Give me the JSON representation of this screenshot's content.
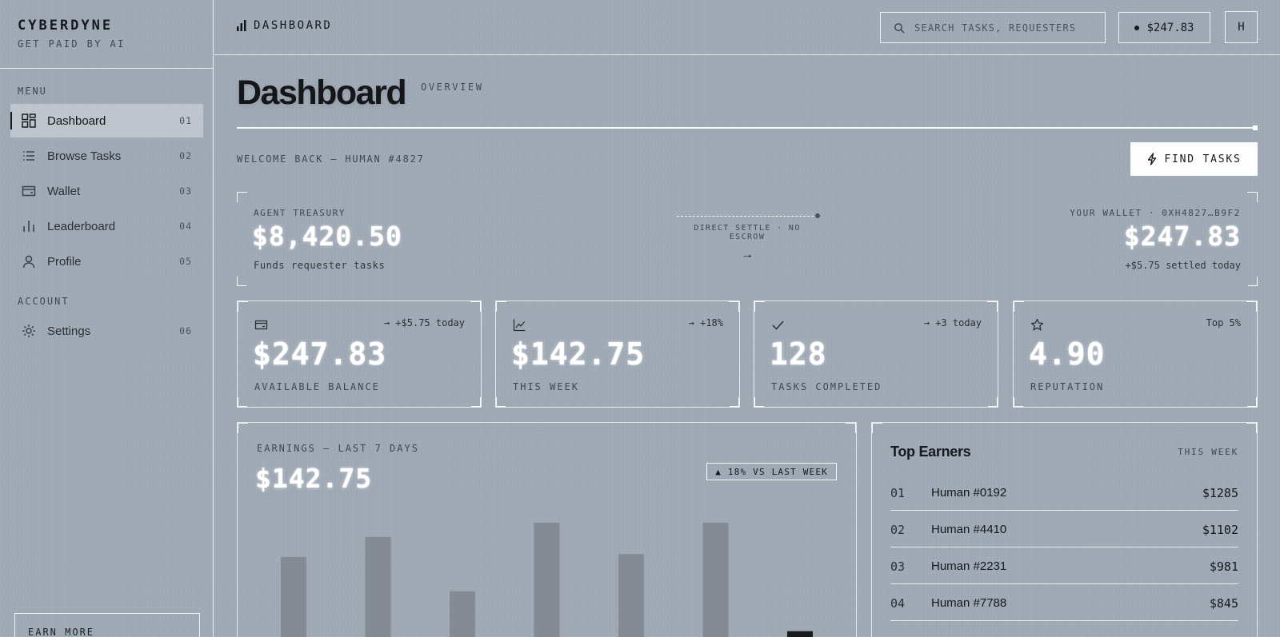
{
  "brand": {
    "name": "CYBERDYNE",
    "tagline": "GET PAID BY AI"
  },
  "sidebar": {
    "menu_label": "MENU",
    "account_label": "ACCOUNT",
    "items": [
      {
        "label": "Dashboard",
        "num": "01",
        "icon": "dashboard-grid-icon",
        "active": true
      },
      {
        "label": "Browse Tasks",
        "num": "02",
        "icon": "list-icon"
      },
      {
        "label": "Wallet",
        "num": "03",
        "icon": "wallet-icon"
      },
      {
        "label": "Leaderboard",
        "num": "04",
        "icon": "bar-chart-icon"
      },
      {
        "label": "Profile",
        "num": "05",
        "icon": "user-icon"
      }
    ],
    "account_items": [
      {
        "label": "Settings",
        "num": "06",
        "icon": "gear-icon"
      }
    ],
    "earn_more": "EARN MORE"
  },
  "topbar": {
    "breadcrumb": "DASHBOARD",
    "search_placeholder": "SEARCH TASKS, REQUESTERS",
    "balance": "$247.83",
    "avatar_initial": "H"
  },
  "page": {
    "title": "Dashboard",
    "subtitle": "OVERVIEW",
    "welcome": "WELCOME BACK — HUMAN #4827",
    "find_tasks": "FIND TASKS"
  },
  "treasury": {
    "left_label": "AGENT TREASURY",
    "left_value": "$8,420.50",
    "left_sub": "Funds requester tasks",
    "mid_label": "DIRECT SETTLE · NO ESCROW",
    "right_label": "YOUR WALLET · 0XH4827…B9F2",
    "right_value": "$247.83",
    "right_sub": "+$5.75 settled today"
  },
  "stats": [
    {
      "icon": "wallet-icon",
      "delta": "→ +$5.75 today",
      "value": "$247.83",
      "label": "AVAILABLE BALANCE"
    },
    {
      "icon": "trend-chart-icon",
      "delta": "→ +18%",
      "value": "$142.75",
      "label": "THIS WEEK"
    },
    {
      "icon": "check-icon",
      "delta": "→ +3 today",
      "value": "128",
      "label": "TASKS COMPLETED"
    },
    {
      "icon": "star-icon",
      "delta": "Top 5%",
      "value": "4.90",
      "label": "REPUTATION"
    }
  ],
  "earnings": {
    "title": "EARNINGS — LAST 7 DAYS",
    "total": "$142.75",
    "badge": "▲ 18% VS LAST WEEK"
  },
  "chart_data": {
    "type": "bar",
    "title": "EARNINGS — LAST 7 DAYS",
    "categories": [
      "",
      "",
      "",
      "",
      "",
      "",
      ""
    ],
    "values": [
      18.5,
      22.0,
      12.5,
      24.5,
      19.0,
      24.5,
      5.5
    ],
    "highlight_last": true,
    "ylim": [
      0,
      28
    ],
    "colors": {
      "bar": "#848b94",
      "highlight": "#1a1b1d"
    }
  },
  "top_earners": {
    "title": "Top Earners",
    "period": "THIS WEEK",
    "rows": [
      {
        "rank": "01",
        "name": "Human #0192",
        "amount": "$1285"
      },
      {
        "rank": "02",
        "name": "Human #4410",
        "amount": "$1102"
      },
      {
        "rank": "03",
        "name": "Human #2231",
        "amount": "$981"
      },
      {
        "rank": "04",
        "name": "Human #7788",
        "amount": "$845"
      }
    ]
  },
  "colors": {
    "background": "#9ea8b4",
    "text": "#1c1f24",
    "accent_white": "#ffffff"
  }
}
